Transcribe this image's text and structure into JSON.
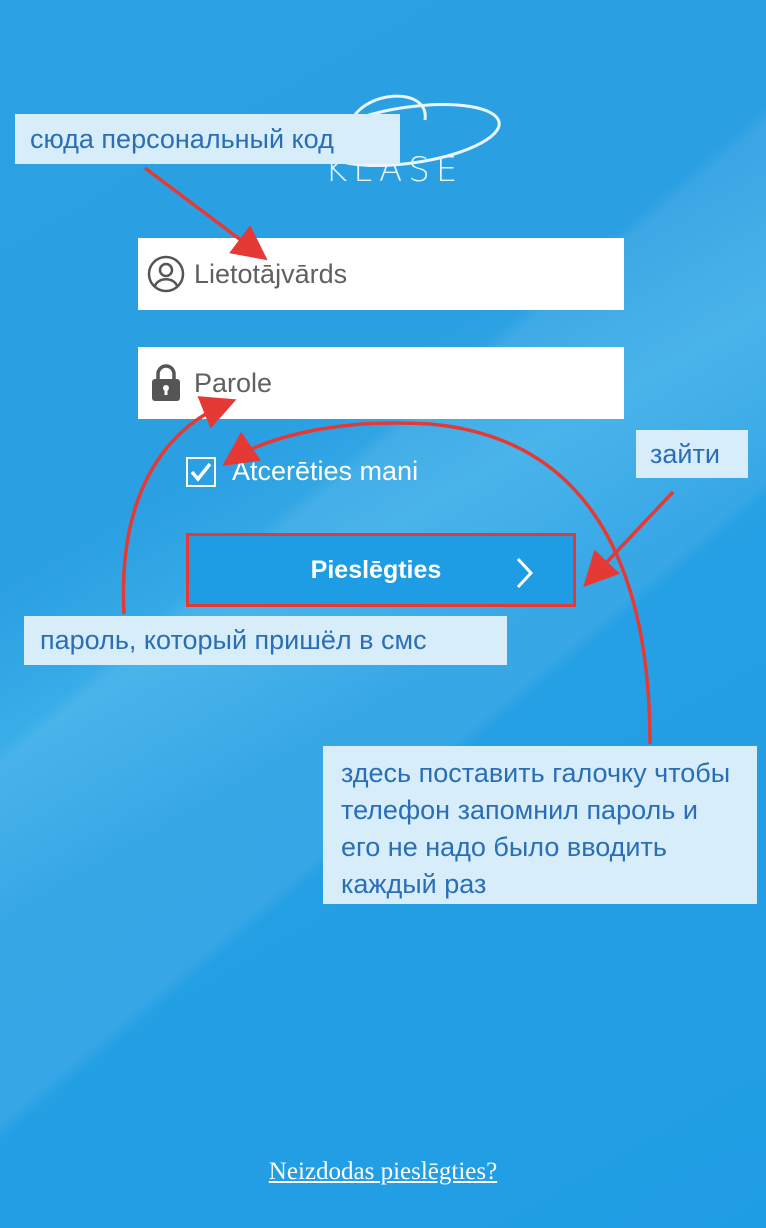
{
  "logo": {
    "text": "KLASE"
  },
  "form": {
    "username_placeholder": "Lietotājvārds",
    "password_placeholder": "Parole",
    "remember_label": "Atcerēties mani",
    "remember_checked": true,
    "login_label": "Pieslēgties",
    "forgot_link": "Neizdodas pieslēgties?"
  },
  "annotations": {
    "code_note": "сюда персональный код",
    "login_note": "зайти",
    "password_note": "пароль, который пришёл в смс",
    "remember_note": "здесь поставить галочку чтобы телефон запомнил пароль и его не надо было вводить каждый раз"
  },
  "colors": {
    "background": "#1f9de4",
    "annotation_bg": "#d7edf9",
    "annotation_text": "#2a6eb8",
    "arrow": "#e53935"
  },
  "icons": [
    "user-icon",
    "lock-icon",
    "check-icon",
    "chevron-right-icon"
  ]
}
